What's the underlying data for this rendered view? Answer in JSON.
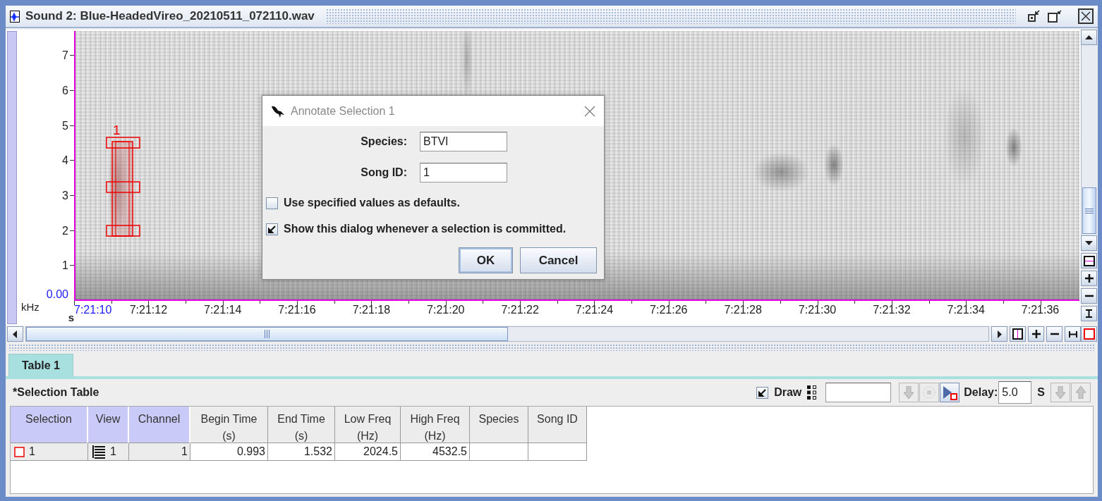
{
  "window": {
    "title": "Sound 2: Blue-HeadedVireo_20210511_072110.wav"
  },
  "spectrogram": {
    "y_axis": {
      "ticks": [
        "7",
        "6",
        "5",
        "4",
        "3",
        "2",
        "1"
      ],
      "origin": "0.00",
      "unit": "kHz"
    },
    "x_axis": {
      "unit": "s",
      "origin": "7:21:10",
      "ticks": [
        "7:21:12",
        "7:21:14",
        "7:21:16",
        "7:21:18",
        "7:21:20",
        "7:21:22",
        "7:21:24",
        "7:21:26",
        "7:21:28",
        "7:21:30",
        "7:21:32",
        "7:21:34",
        "7:21:36"
      ]
    },
    "selection": {
      "label": "1"
    }
  },
  "dialog": {
    "title": "Annotate Selection 1",
    "fields": [
      {
        "label": "Species:",
        "value": "BTVI"
      },
      {
        "label": "Song ID:",
        "value": "1"
      }
    ],
    "options": [
      {
        "label": "Use specified values as defaults.",
        "checked": false
      },
      {
        "label": "Show this dialog whenever a selection is committed.",
        "checked": true
      }
    ],
    "buttons": [
      "OK",
      "Cancel"
    ]
  },
  "tabs": [
    {
      "label": "Table 1",
      "selected": true
    }
  ],
  "table_toolbar": {
    "title": "*Selection Table",
    "draw": {
      "label": "Draw",
      "checked": true
    },
    "delay": {
      "label": "Delay:",
      "value": "5.0",
      "unit": "S"
    }
  },
  "table": {
    "columns": [
      {
        "title": "Selection",
        "kind": "key"
      },
      {
        "title": "View",
        "kind": "key"
      },
      {
        "title": "Channel",
        "kind": "key"
      },
      {
        "title": "Begin Time",
        "unit": "(s)",
        "kind": "measure"
      },
      {
        "title": "End Time",
        "unit": "(s)",
        "kind": "measure"
      },
      {
        "title": "Low Freq",
        "unit": "(Hz)",
        "kind": "measure"
      },
      {
        "title": "High Freq",
        "unit": "(Hz)",
        "kind": "measure"
      },
      {
        "title": "Species",
        "kind": "measure"
      },
      {
        "title": "Song ID",
        "kind": "measure"
      }
    ],
    "rows": [
      {
        "cells": [
          "1",
          "1",
          "1",
          "0.993",
          "1.532",
          "2024.5",
          "4532.5"
        ]
      }
    ]
  }
}
